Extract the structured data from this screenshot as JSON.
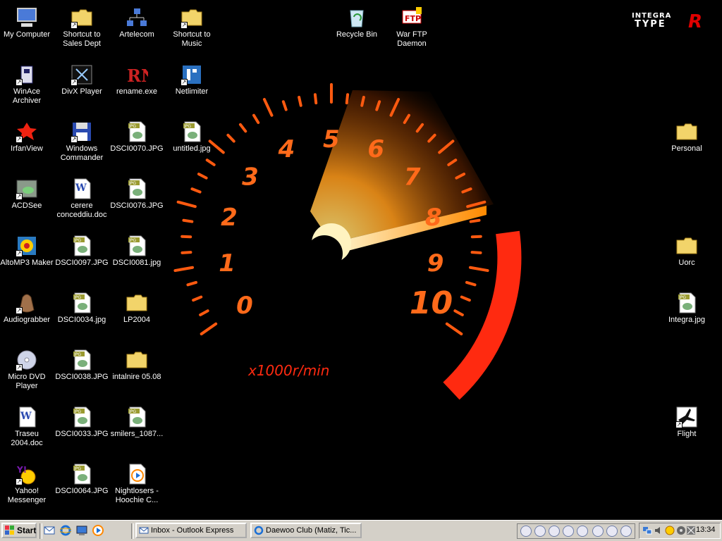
{
  "brand": {
    "line1": "INTEGRA",
    "line2": "TYPE",
    "letter": "R"
  },
  "wallpaper": {
    "gauge_numbers": [
      "0",
      "1",
      "2",
      "3",
      "4",
      "5",
      "6",
      "7",
      "8",
      "9",
      "10"
    ],
    "unit": "x1000r/min"
  },
  "desktop_icons": [
    {
      "label": "My Computer",
      "icon": "computer-icon",
      "shortcut": false
    },
    {
      "label": "Shortcut to Sales Dept",
      "icon": "folder-icon",
      "shortcut": true
    },
    {
      "label": "Artelecom",
      "icon": "network-icon",
      "shortcut": false
    },
    {
      "label": "Shortcut to Music",
      "icon": "folder-icon",
      "shortcut": true
    },
    {
      "label": "Recycle Bin",
      "icon": "recycle-bin-icon",
      "shortcut": false
    },
    {
      "label": "War FTP Daemon",
      "icon": "ftp-icon",
      "shortcut": false
    },
    {
      "label": "WinAce Archiver",
      "icon": "archiver-icon",
      "shortcut": true
    },
    {
      "label": "DivX Player",
      "icon": "divx-icon",
      "shortcut": true
    },
    {
      "label": "rename.exe",
      "icon": "rename-icon",
      "shortcut": false
    },
    {
      "label": "Netlimiter",
      "icon": "netlimiter-icon",
      "shortcut": true
    },
    {
      "label": "IrfanView",
      "icon": "irfanview-icon",
      "shortcut": true
    },
    {
      "label": "Windows Commander",
      "icon": "floppy-icon",
      "shortcut": true
    },
    {
      "label": "DSCI0070.JPG",
      "icon": "jpg-file-icon",
      "shortcut": false
    },
    {
      "label": "untitled.jpg",
      "icon": "jpg-file-icon",
      "shortcut": false
    },
    {
      "label": "Personal",
      "icon": "folder-icon",
      "shortcut": false
    },
    {
      "label": "ACDSee",
      "icon": "acdsee-icon",
      "shortcut": true
    },
    {
      "label": "cerere conceddiu.doc",
      "icon": "word-doc-icon",
      "shortcut": false
    },
    {
      "label": "DSCI0076.JPG",
      "icon": "jpg-file-icon",
      "shortcut": false
    },
    {
      "label": "AltoMP3 Maker",
      "icon": "mp3-maker-icon",
      "shortcut": true
    },
    {
      "label": "DSCI0097.JPG",
      "icon": "jpg-file-icon",
      "shortcut": false
    },
    {
      "label": "DSCI0081.jpg",
      "icon": "jpg-file-icon",
      "shortcut": false
    },
    {
      "label": "Uorc",
      "icon": "folder-icon",
      "shortcut": false
    },
    {
      "label": "Audiograbber",
      "icon": "audiograbber-icon",
      "shortcut": true
    },
    {
      "label": "DSCI0034.jpg",
      "icon": "jpg-file-icon",
      "shortcut": false
    },
    {
      "label": "LP2004",
      "icon": "folder-icon",
      "shortcut": false
    },
    {
      "label": "Integra.jpg",
      "icon": "jpg-file-icon",
      "shortcut": false
    },
    {
      "label": "Micro DVD Player",
      "icon": "dvd-icon",
      "shortcut": true
    },
    {
      "label": "DSCI0038.JPG",
      "icon": "jpg-file-icon",
      "shortcut": false
    },
    {
      "label": "intalnire 05.08",
      "icon": "folder-icon",
      "shortcut": false
    },
    {
      "label": "Traseu 2004.doc",
      "icon": "word-doc-icon",
      "shortcut": false
    },
    {
      "label": "DSCI0033.JPG",
      "icon": "jpg-file-icon",
      "shortcut": false
    },
    {
      "label": "smilers_1087...",
      "icon": "jpg-file-icon",
      "shortcut": false
    },
    {
      "label": "Flight",
      "icon": "flight-icon",
      "shortcut": true
    },
    {
      "label": "Yahoo! Messenger",
      "icon": "yahoo-icon",
      "shortcut": true
    },
    {
      "label": "DSCI0064.JPG",
      "icon": "jpg-file-icon",
      "shortcut": false
    },
    {
      "label": "Nightlosers - Hoochie C...",
      "icon": "media-file-icon",
      "shortcut": false
    }
  ],
  "taskbar": {
    "start_label": "Start",
    "quick_launch": [
      "outlook-express-icon",
      "internet-explorer-icon",
      "show-desktop-icon",
      "media-player-icon"
    ],
    "tasks": [
      {
        "label": "Inbox - Outlook Express",
        "icon": "mail-icon"
      },
      {
        "label": "Daewoo Club (Matiz, Tic...",
        "icon": "internet-explorer-icon"
      }
    ],
    "tray_icons": [
      "network-icon",
      "volume-icon",
      "yahoo-icon",
      "media-icon",
      "antivirus-icon"
    ],
    "clock": "13:34"
  }
}
